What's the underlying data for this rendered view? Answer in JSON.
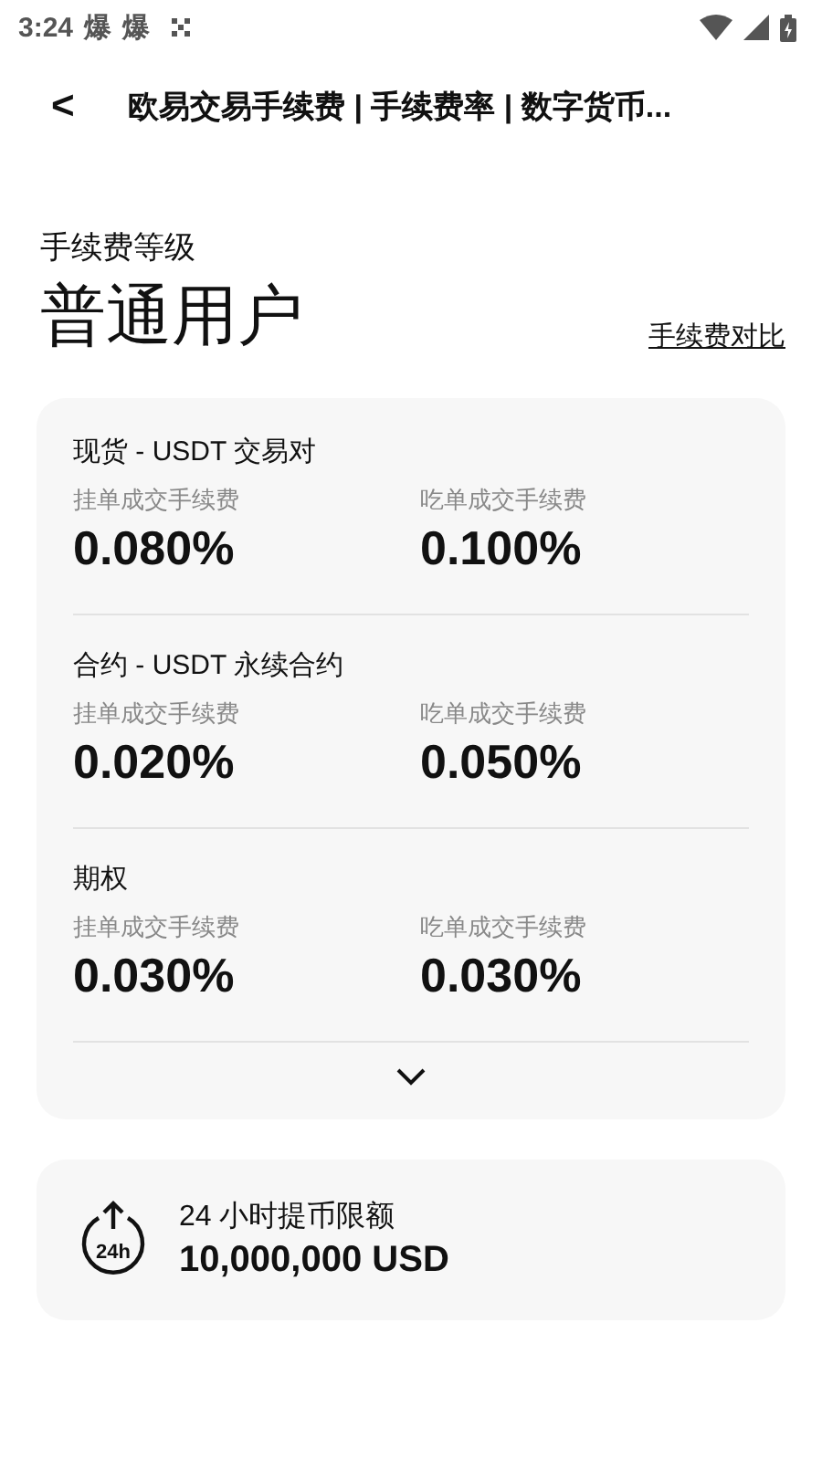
{
  "status_bar": {
    "time": "3:24",
    "notification_glyphs": [
      "爆",
      "爆"
    ]
  },
  "header": {
    "back": "<",
    "title": "欧易交易手续费 | 手续费率 | 数字货币..."
  },
  "level": {
    "label": "手续费等级",
    "value": "普通用户",
    "compare_link": "手续费对比"
  },
  "fee_sections": [
    {
      "title": "现货 - USDT 交易对",
      "maker_label": "挂单成交手续费",
      "maker_value": "0.080%",
      "taker_label": "吃单成交手续费",
      "taker_value": "0.100%"
    },
    {
      "title": "合约 - USDT 永续合约",
      "maker_label": "挂单成交手续费",
      "maker_value": "0.020%",
      "taker_label": "吃单成交手续费",
      "taker_value": "0.050%"
    },
    {
      "title": "期权",
      "maker_label": "挂单成交手续费",
      "maker_value": "0.030%",
      "taker_label": "吃单成交手续费",
      "taker_value": "0.030%"
    }
  ],
  "expanded": false,
  "withdrawal": {
    "icon_text": "24h",
    "label": "24 小时提币限额",
    "value": "10,000,000 USD"
  }
}
